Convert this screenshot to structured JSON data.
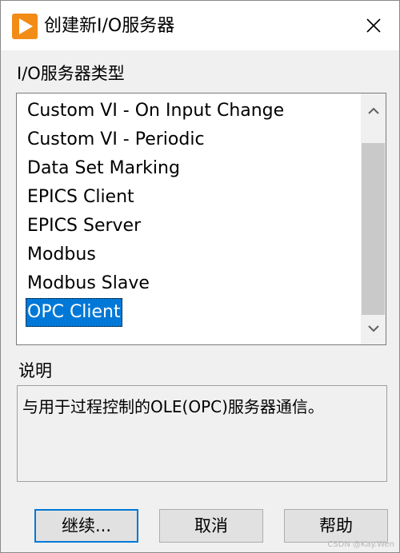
{
  "window": {
    "title": "创建新I/O服务器",
    "app_icon": "labview-run-arrow-icon",
    "accent_color": "#f28c16"
  },
  "server_type": {
    "label": "I/O服务器类型",
    "items": [
      "Custom VI - On Input Change",
      "Custom VI - Periodic",
      "Data Set Marking",
      "EPICS Client",
      "EPICS Server",
      "Modbus",
      "Modbus Slave",
      "OPC Client"
    ],
    "selected": "OPC Client",
    "selection_color": "#0078d7"
  },
  "description": {
    "label": "说明",
    "text": "与用于过程控制的OLE(OPC)服务器通信。"
  },
  "buttons": {
    "continue": "继续...",
    "cancel": "取消",
    "help": "帮助"
  },
  "watermark": "CSDN @Kay.Wen"
}
